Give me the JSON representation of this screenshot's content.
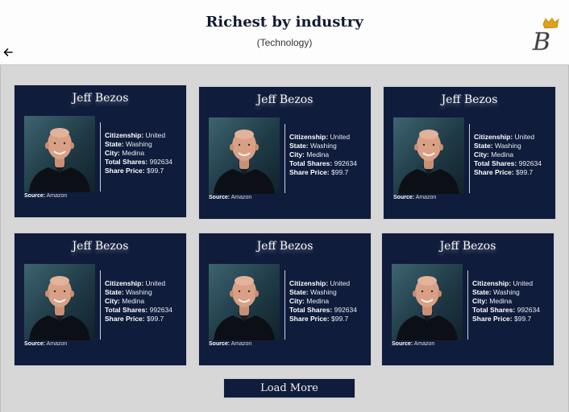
{
  "header": {
    "title": "Richest by industry",
    "subtitle": "(Technology)",
    "back_icon": "arrow-left-icon",
    "logo_letter": "B"
  },
  "labels": {
    "citizenship": "Citizenship:",
    "state": "State:",
    "city": "City:",
    "total_shares": "Total Shares:",
    "share_price": "Share Price:",
    "source": "Source:"
  },
  "cards": [
    {
      "name": "Jeff Bezos",
      "citizenship": "United",
      "state": "Washing",
      "city": "Medina",
      "total_shares": "992634",
      "share_price": "$99.7",
      "source": "Amazon"
    },
    {
      "name": "Jeff Bezos",
      "citizenship": "United",
      "state": "Washing",
      "city": "Medina",
      "total_shares": "992634",
      "share_price": "$99.7",
      "source": "Amazon"
    },
    {
      "name": "Jeff Bezos",
      "citizenship": "United",
      "state": "Washing",
      "city": "Medina",
      "total_shares": "992634",
      "share_price": "$99.7",
      "source": "Amazon"
    },
    {
      "name": "Jeff Bezos",
      "citizenship": "United",
      "state": "Washing",
      "city": "Medina",
      "total_shares": "992634",
      "share_price": "$99.7",
      "source": "Amazon"
    },
    {
      "name": "Jeff Bezos",
      "citizenship": "United",
      "state": "Washing",
      "city": "Medina",
      "total_shares": "992634",
      "share_price": "$99.7",
      "source": "Amazon"
    },
    {
      "name": "Jeff Bezos",
      "citizenship": "United",
      "state": "Washing",
      "city": "Medina",
      "total_shares": "992634",
      "share_price": "$99.7",
      "source": "Amazon"
    }
  ],
  "load_more_label": "Load More",
  "colors": {
    "card_bg": "#101c3b",
    "page_bg": "#d7d7d7",
    "header_bg": "#fdfdfd",
    "logo_crown": "#e0a019"
  }
}
